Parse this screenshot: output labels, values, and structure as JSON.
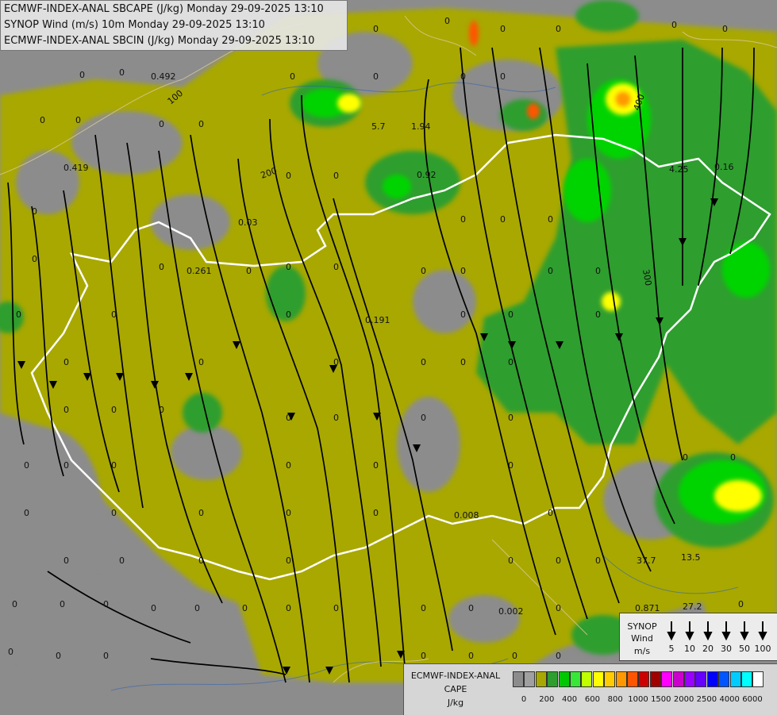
{
  "titles": [
    "ECMWF-INDEX-ANAL SBCAPE (J/kg) Monday 29-09-2025 13:10",
    "SYNOP Wind (m/s) 10m Monday 29-09-2025 13:10",
    "ECMWF-INDEX-ANAL SBCIN (J/kg) Monday 29-09-2025 13:10"
  ],
  "legend": {
    "title_lines": [
      "ECMWF-INDEX-ANAL",
      "CAPE",
      "J/kg"
    ],
    "ticks": [
      "0",
      "200",
      "400",
      "600",
      "800",
      "1000",
      "1500",
      "2000",
      "2500",
      "4000",
      "6000"
    ],
    "colors": [
      "#8c8c8c",
      "#a0a0a0",
      "#a8a800",
      "#2e9e2e",
      "#00c800",
      "#37e837",
      "#bfff00",
      "#ffff00",
      "#ffcc00",
      "#ff9900",
      "#ff5500",
      "#cc0000",
      "#a00000",
      "#ff00ff",
      "#cc00cc",
      "#9900ff",
      "#6600ff",
      "#0000ff",
      "#0055ff",
      "#00ccff",
      "#00ffff",
      "#ffffff"
    ]
  },
  "wind_legend": {
    "title_lines": [
      "SYNOP",
      "Wind",
      "m/s"
    ],
    "values": [
      "5",
      "10",
      "20",
      "30",
      "50",
      "100"
    ]
  },
  "map_labels": [
    "0",
    "0.492",
    "100",
    "0.419",
    "0.261",
    "0.03",
    "0.191",
    "5.7",
    "1.94",
    "0.92",
    "4.25",
    "0.008",
    "0.002",
    "37.7",
    "13.5",
    "0.871",
    "27.2",
    "200",
    "300",
    "400",
    "0.16"
  ]
}
